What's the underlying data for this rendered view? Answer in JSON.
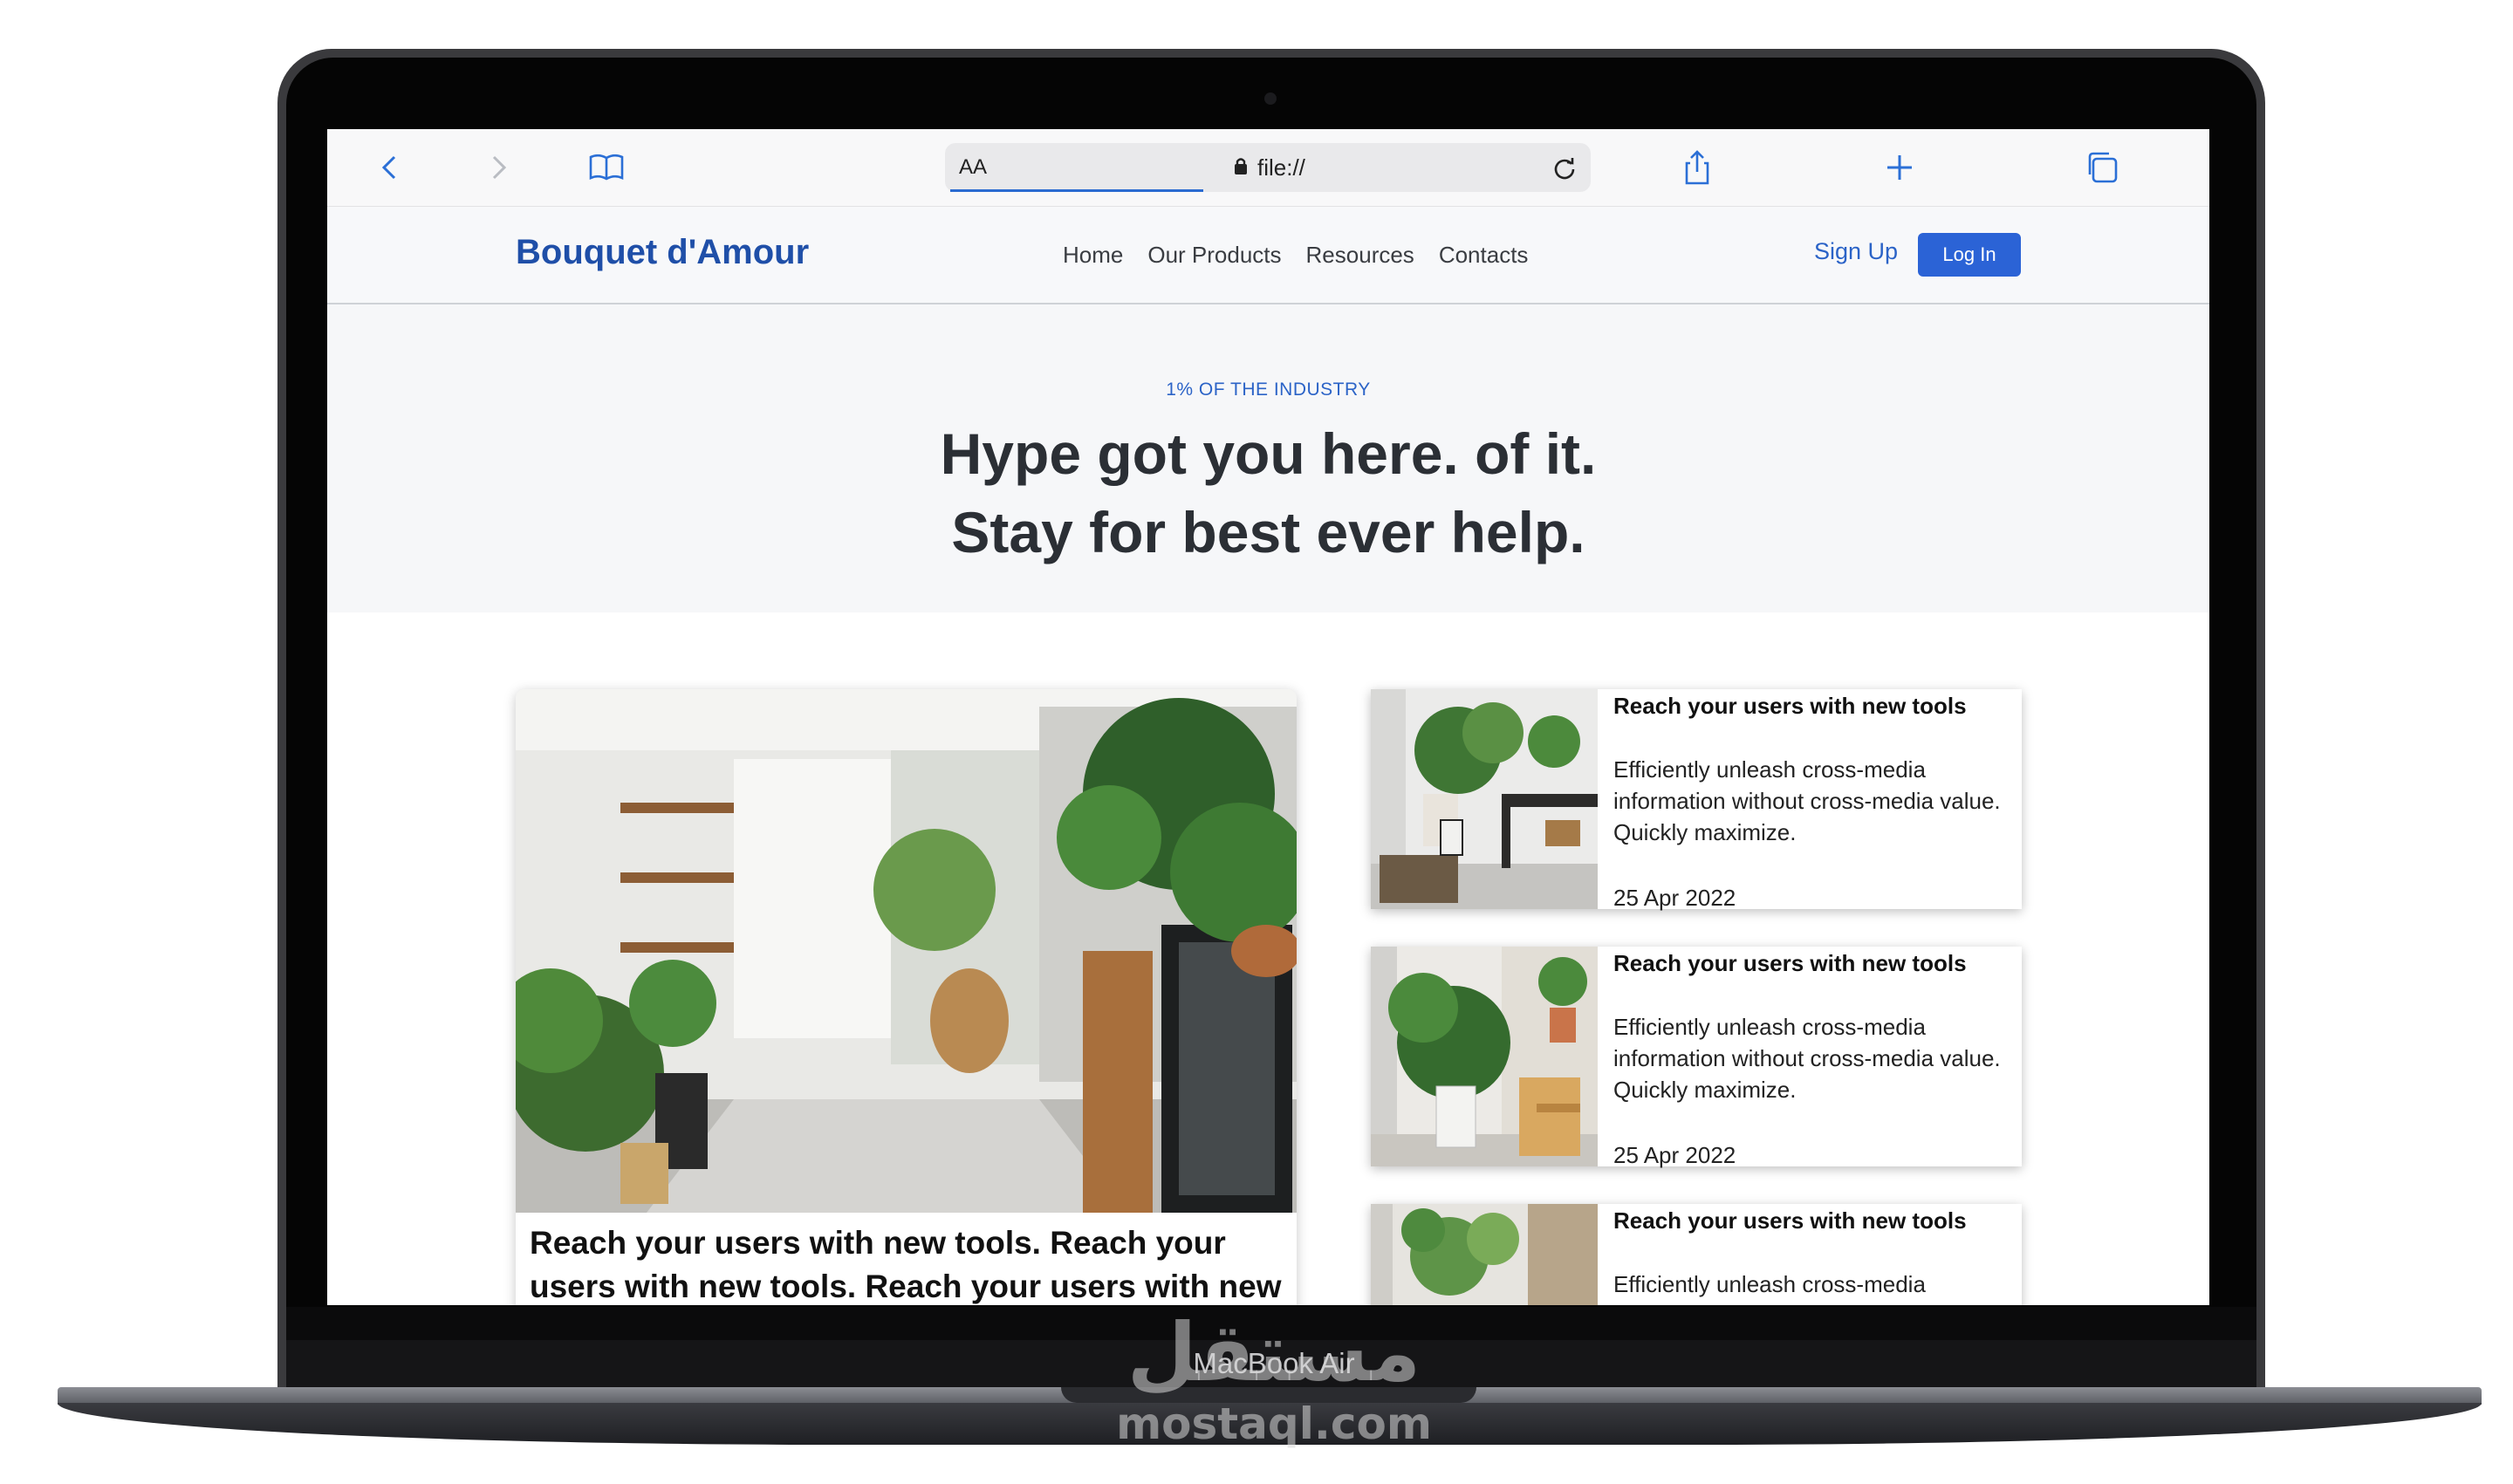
{
  "device": {
    "model_label": "MacBook Air"
  },
  "watermark": {
    "arabic": "مستقل",
    "latin": "mostaql.com"
  },
  "browser": {
    "aa_label": "AA",
    "url": "file://",
    "icons": [
      "back-icon",
      "forward-icon",
      "bookmarks-icon",
      "lock-icon",
      "reload-icon",
      "share-icon",
      "new-tab-icon",
      "tabs-icon"
    ]
  },
  "header": {
    "brand": "Bouquet d'Amour",
    "nav": [
      "Home",
      "Our Products",
      "Resources",
      "Contacts"
    ],
    "signup": "Sign Up",
    "login": "Log In"
  },
  "hero": {
    "eyebrow": "1% OF THE INDUSTRY",
    "title_line1": "Hype got you here. of it.",
    "title_line2": "Stay for best ever help."
  },
  "feature": {
    "title": "Reach your users with new tools. Reach your users with new tools. Reach your users with new tools."
  },
  "cards": [
    {
      "title": "Reach your users with new tools",
      "text": "Efficiently unleash cross-media information without cross-media value. Quickly maximize.",
      "date": "25 Apr 2022"
    },
    {
      "title": "Reach your users with new tools",
      "text": "Efficiently unleash cross-media information without cross-media value. Quickly maximize.",
      "date": "25 Apr 2022"
    },
    {
      "title": "Reach your users with new tools",
      "text": "Efficiently unleash cross-media",
      "date": ""
    }
  ],
  "colors": {
    "brand": "#1f4fa8",
    "accent": "#2b63d6",
    "hero_bg": "#f6f7f9"
  }
}
